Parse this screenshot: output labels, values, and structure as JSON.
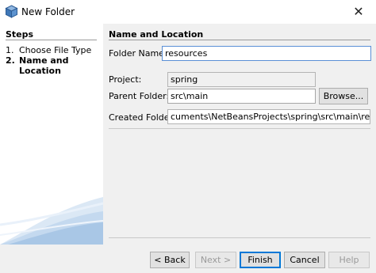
{
  "window": {
    "title": "New Folder"
  },
  "steps": {
    "heading": "Steps",
    "items": [
      {
        "num": "1.",
        "label": "Choose File Type",
        "active": false
      },
      {
        "num": "2.",
        "label": "Name and Location",
        "active": true
      }
    ]
  },
  "form": {
    "heading": "Name and Location",
    "folder_name_label": "Folder Name:",
    "folder_name_value": "resources",
    "project_label": "Project:",
    "project_value": "spring",
    "parent_folder_label": "Parent Folder:",
    "parent_folder_value": "src\\main",
    "browse_label": "Browse...",
    "created_folder_label": "Created Folder:",
    "created_folder_value": "cuments\\NetBeansProjects\\spring\\src\\main\\resources"
  },
  "buttons": {
    "back": "< Back",
    "next": "Next >",
    "finish": "Finish",
    "cancel": "Cancel",
    "help": "Help"
  }
}
